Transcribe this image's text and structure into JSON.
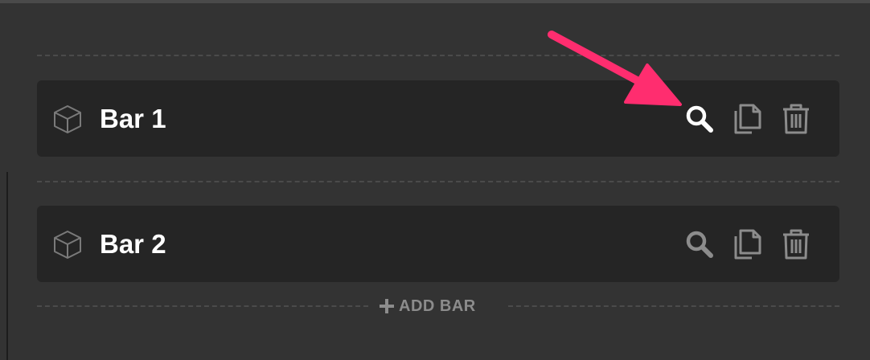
{
  "colors": {
    "background": "#333333",
    "row_background": "#252525",
    "divider": "#4b4b4b",
    "icon_active": "#ffffff",
    "icon_muted": "#8c8c8c",
    "arrow": "#ff2d6f"
  },
  "bars": [
    {
      "label": "Bar 1",
      "icons": [
        "cube-icon",
        "search-icon",
        "copy-icon",
        "trash-icon"
      ],
      "search_highlighted": true
    },
    {
      "label": "Bar 2",
      "icons": [
        "cube-icon",
        "search-icon",
        "copy-icon",
        "trash-icon"
      ],
      "search_highlighted": false
    }
  ],
  "add_bar": {
    "label": "ADD BAR",
    "icon": "plus-icon"
  },
  "annotation": {
    "icon": "arrow-icon",
    "points_to": "search-icon"
  }
}
